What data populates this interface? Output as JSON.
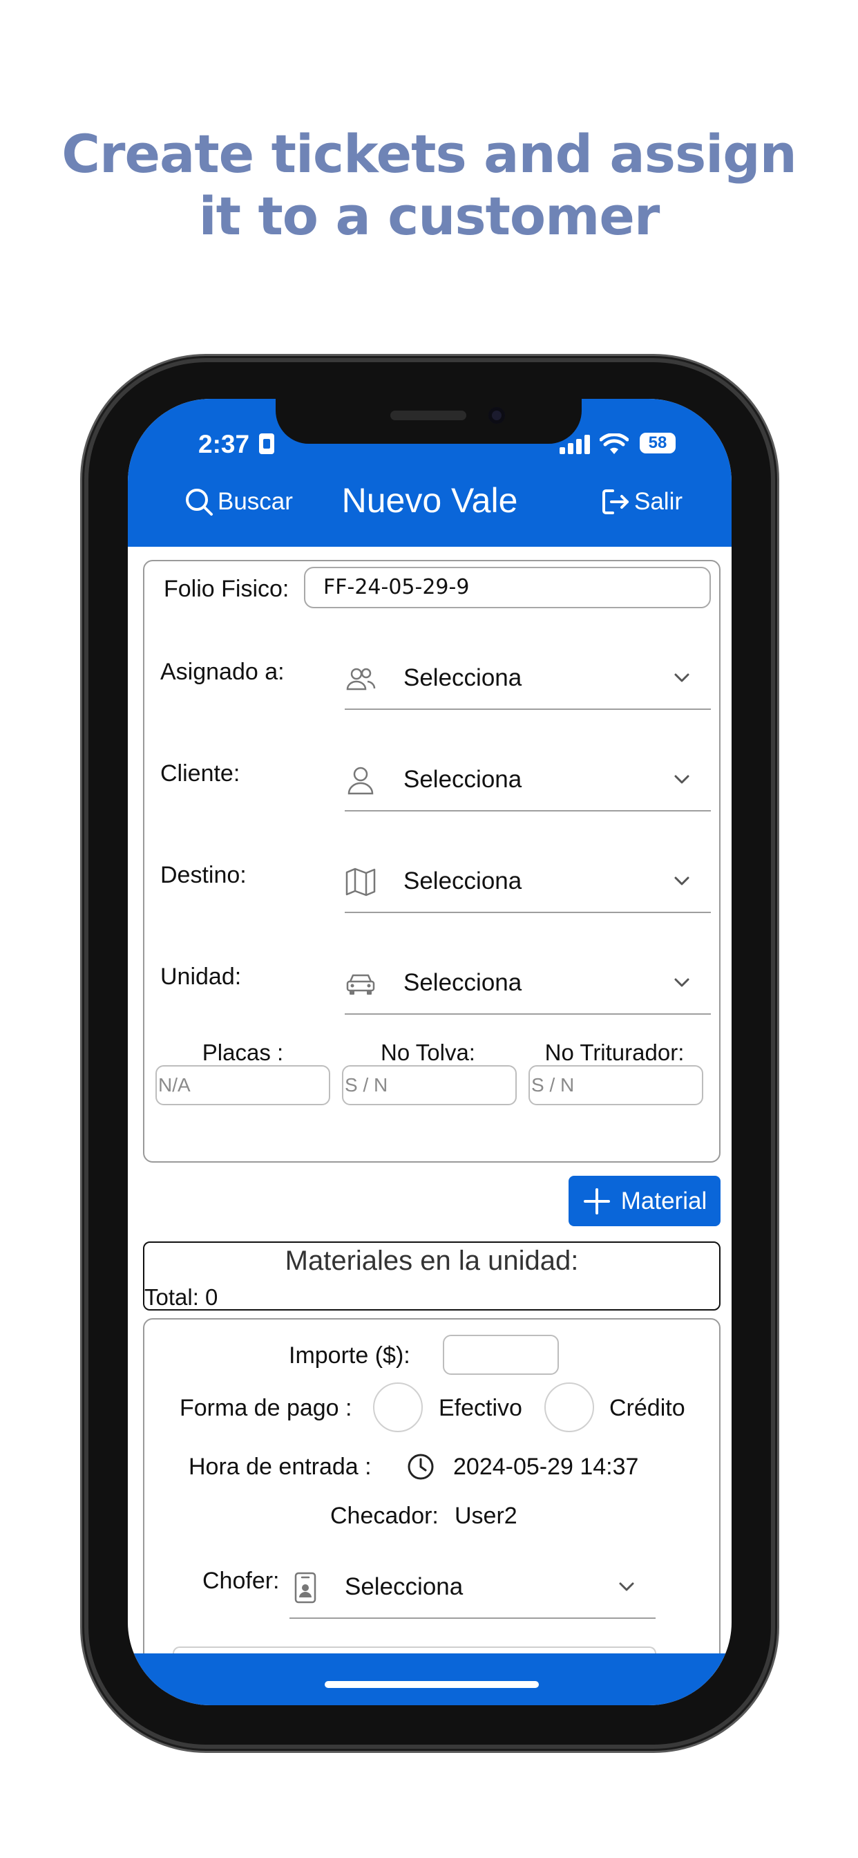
{
  "headline": {
    "line1": "Create tickets and assign",
    "line2": "it to a customer"
  },
  "status": {
    "time": "2:37",
    "battery": "58"
  },
  "nav": {
    "search_label": "Buscar",
    "title": "Nuevo Vale",
    "exit_label": "Salir"
  },
  "form": {
    "folio_label": "Folio Fisico:",
    "folio_value": "FF-24-05-29-9",
    "selects": [
      {
        "label": "Asignado a:",
        "icon": "users-icon",
        "value": "Selecciona"
      },
      {
        "label": "Cliente:",
        "icon": "user-icon",
        "value": "Selecciona"
      },
      {
        "label": "Destino:",
        "icon": "map-icon",
        "value": "Selecciona"
      },
      {
        "label": "Unidad:",
        "icon": "car-icon",
        "value": "Selecciona"
      }
    ],
    "placas_label": "Placas :",
    "placas_placeholder": "N/A",
    "tolva_label": "No Tolva:",
    "tolva_placeholder": "S / N",
    "triturador_label": "No Triturador:",
    "triturador_placeholder": "S / N"
  },
  "material_button": "Material",
  "materials": {
    "title": "Materiales en la unidad:",
    "total": "Total: 0"
  },
  "payment": {
    "importe_label": "Importe ($):",
    "forma_label": "Forma de pago :",
    "option_cash": "Efectivo",
    "option_credit": "Crédito",
    "hora_label": "Hora de entrada :",
    "hora_value": "2024-05-29 14:37",
    "checador_label": "Checador:",
    "checador_value": "User2",
    "chofer_label": "Chofer:",
    "chofer_value": "Selecciona"
  },
  "colors": {
    "accent": "#0a66d9",
    "headline": "#6f84b6"
  }
}
